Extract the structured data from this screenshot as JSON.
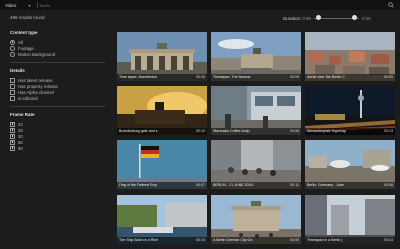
{
  "topbar": {
    "type_value": "Video",
    "search_placeholder": "Berlin"
  },
  "results": {
    "count_text": "496 results found"
  },
  "duration": {
    "label": "Duration:",
    "min": "0:00",
    "max": "0:15",
    "range_min_fraction": 0.05,
    "range_max_fraction": 0.95
  },
  "filters": {
    "content_type": {
      "title": "Content type",
      "options": [
        {
          "label": "All",
          "selected": true
        },
        {
          "label": "Footage",
          "selected": false
        },
        {
          "label": "Motion Background",
          "selected": false
        }
      ]
    },
    "details": {
      "title": "Details",
      "options": [
        {
          "label": "Has talent release",
          "checked": false
        },
        {
          "label": "Has property release",
          "checked": false
        },
        {
          "label": "Has Alpha channel",
          "checked": false
        },
        {
          "label": "Is editorial",
          "checked": false
        }
      ]
    },
    "frame_rate": {
      "title": "Frame Rate",
      "options": [
        {
          "label": "24",
          "checked": true
        },
        {
          "label": "25",
          "checked": true
        },
        {
          "label": "30",
          "checked": true
        },
        {
          "label": "50",
          "checked": true
        },
        {
          "label": "60",
          "checked": true
        }
      ]
    }
  },
  "results_grid": [
    {
      "title": "Time lapse, Brandenbur",
      "duration": "00:09"
    },
    {
      "title": "Timelapse, The famous",
      "duration": "00:09"
    },
    {
      "title": "Aerial view 'the Berlin C",
      "duration": "00:09"
    },
    {
      "title": "Brandenburg gate and s",
      "duration": "00:12"
    },
    {
      "title": "Starbucks Coffee footp",
      "duration": "00:08"
    },
    {
      "title": "Alexanderplatz Hyperlap",
      "duration": "00:13"
    },
    {
      "title": "Flag of the Federal Rep",
      "duration": "00:07"
    },
    {
      "title": "BERLIN - 21 JUNE 2015:",
      "duration": "00:11"
    },
    {
      "title": "Berlin, Germany - June",
      "duration": "00:08"
    },
    {
      "title": "The Ship Boat on a Rive",
      "duration": "00:15"
    },
    {
      "title": "A Berlin German City Ga",
      "duration": "00:09"
    },
    {
      "title": "Timelapse in a Berlin (",
      "duration": "00:14"
    }
  ],
  "colors": {
    "background": "#1c1c1c",
    "topbar": "#111111",
    "accent_text": "#e6e6e6"
  }
}
